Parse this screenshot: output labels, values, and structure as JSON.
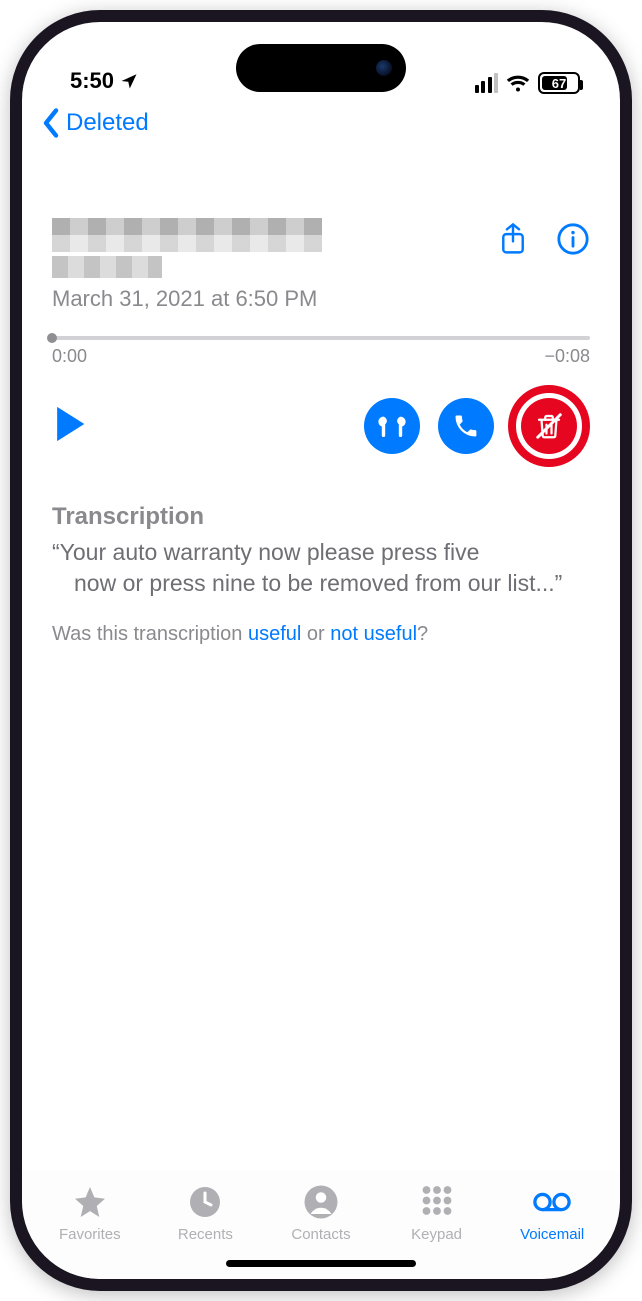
{
  "status_bar": {
    "time": "5:50",
    "battery_pct": "67"
  },
  "nav": {
    "back_label": "Deleted"
  },
  "voicemail": {
    "caller_name": "",
    "timestamp": "March 31, 2021 at 6:50 PM",
    "elapsed": "0:00",
    "remaining": "−0:08"
  },
  "transcription": {
    "title": "Transcription",
    "body_open": "“Your auto warranty now please press five",
    "body_rest": "now or press nine to be removed from our list...”",
    "feedback_prefix": "Was this transcription ",
    "useful": "useful",
    "or": " or ",
    "not_useful": "not useful",
    "q": "?"
  },
  "tabs": {
    "favorites": "Favorites",
    "recents": "Recents",
    "contacts": "Contacts",
    "keypad": "Keypad",
    "voicemail": "Voicemail"
  }
}
